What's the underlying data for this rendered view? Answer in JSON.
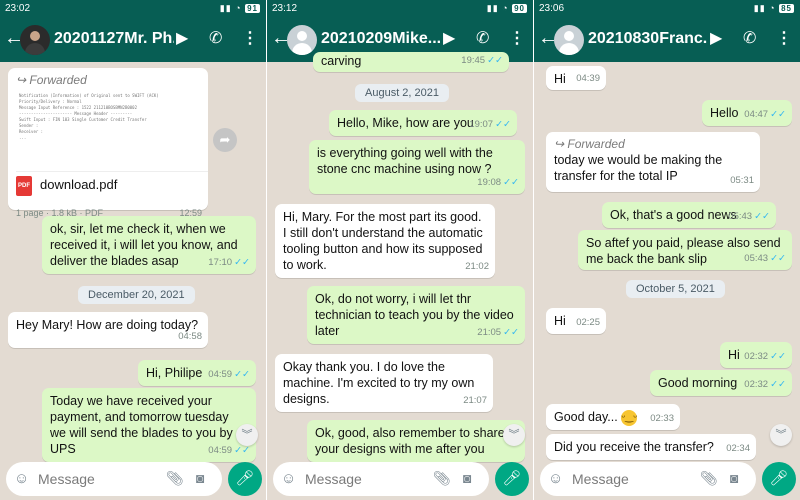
{
  "colors": {
    "header": "#075e54",
    "outgoing": "#dcf8c6",
    "incoming": "#ffffff",
    "wallpaper": "#e3dbd2",
    "mic": "#00a884",
    "read_ticks": "#34b7f1"
  },
  "input": {
    "placeholder": "Message"
  },
  "icons": {
    "back": "arrow-left-icon",
    "video": "video-camera-icon",
    "call": "phone-icon",
    "more": "more-vert-icon",
    "emoji": "emoji-icon",
    "attach": "paperclip-icon",
    "camera": "camera-icon",
    "mic": "microphone-icon",
    "scroll": "chevron-down-icon",
    "share": "forward-share-icon",
    "ticks": "double-check-icon"
  },
  "panels": [
    {
      "status_time": "23:02",
      "battery": "91",
      "title": "20201127Mr. Ph...",
      "document": {
        "forwarded_label": "Forwarded",
        "preview_lines": [
          "Notification (Information) of Original sent to SWIFT (ACK)",
          "Priority/Delivery     : Normal",
          "Message Input Reference : 1522 211210BOSBMN2B0002",
          "---------------------- Message Header ---------",
          "Swift Input   : FIN 103 Single Customer Credit Transfer",
          "Sender  :",
          "",
          "Receiver :",
          "",
          "         ..."
        ],
        "filename": "download.pdf",
        "info": "1 page · 1.8 kB · PDF",
        "time": "12:59"
      },
      "messages": [
        {
          "text": "ok, sir, let me check it, when we received it, i will let you know, and deliver the blades asap",
          "time": "17:10"
        },
        {
          "text": "December 20, 2021"
        },
        {
          "text": "Hey Mary! How are doing today?",
          "time": "04:58"
        },
        {
          "text": "Hi, Philipe",
          "time": "04:59"
        },
        {
          "text": "Today we have received your payment, and tomorrow tuesday we will send the blades to you by UPS",
          "time": "04:59"
        }
      ]
    },
    {
      "status_time": "23:12",
      "battery": "90",
      "title": "20210209Mike...",
      "messages": [
        {
          "text": "carving",
          "time": "19:45"
        },
        {
          "text": "August 2, 2021"
        },
        {
          "text": "Hello, Mike, how are you",
          "time": "19:07"
        },
        {
          "text": "is everything going well with the stone cnc machine using now ?",
          "time": "19:08"
        },
        {
          "text": "Hi, Mary.  For the most part its good.  I still don't understand the automatic tooling button and how its supposed to work.",
          "time": "21:02"
        },
        {
          "text": "Ok, do not worry, i will let thr technician to teach you by the video later",
          "time": "21:05"
        },
        {
          "text": "Okay thank you.  I do love the machine.  I'm excited to try my own designs.",
          "time": "21:07"
        },
        {
          "text": "Ok, good, also remember to share your designs with me after you",
          "time": ""
        }
      ]
    },
    {
      "status_time": "23:06",
      "battery": "85",
      "title": "20210830Franc...",
      "messages": [
        {
          "text": "Hi",
          "time": "04:39"
        },
        {
          "text": "Hello",
          "time": "04:47"
        },
        {
          "forwarded": "Forwarded",
          "text": "today we would be making the transfer for the total IP",
          "time": "05:31"
        },
        {
          "text": "Ok, that's a good news",
          "time": "05:43"
        },
        {
          "text": "So aftef you paid, please also send me back the bank slip",
          "time": "05:43"
        },
        {
          "text": "October 5, 2021"
        },
        {
          "text": "Hi",
          "time": "02:25"
        },
        {
          "text": "Hi",
          "time": "02:32"
        },
        {
          "text": "Good morning",
          "time": "02:32"
        },
        {
          "text": "Good day...",
          "time": "02:33"
        },
        {
          "text": "Did you receive the transfer?",
          "time": "02:34"
        }
      ]
    }
  ]
}
